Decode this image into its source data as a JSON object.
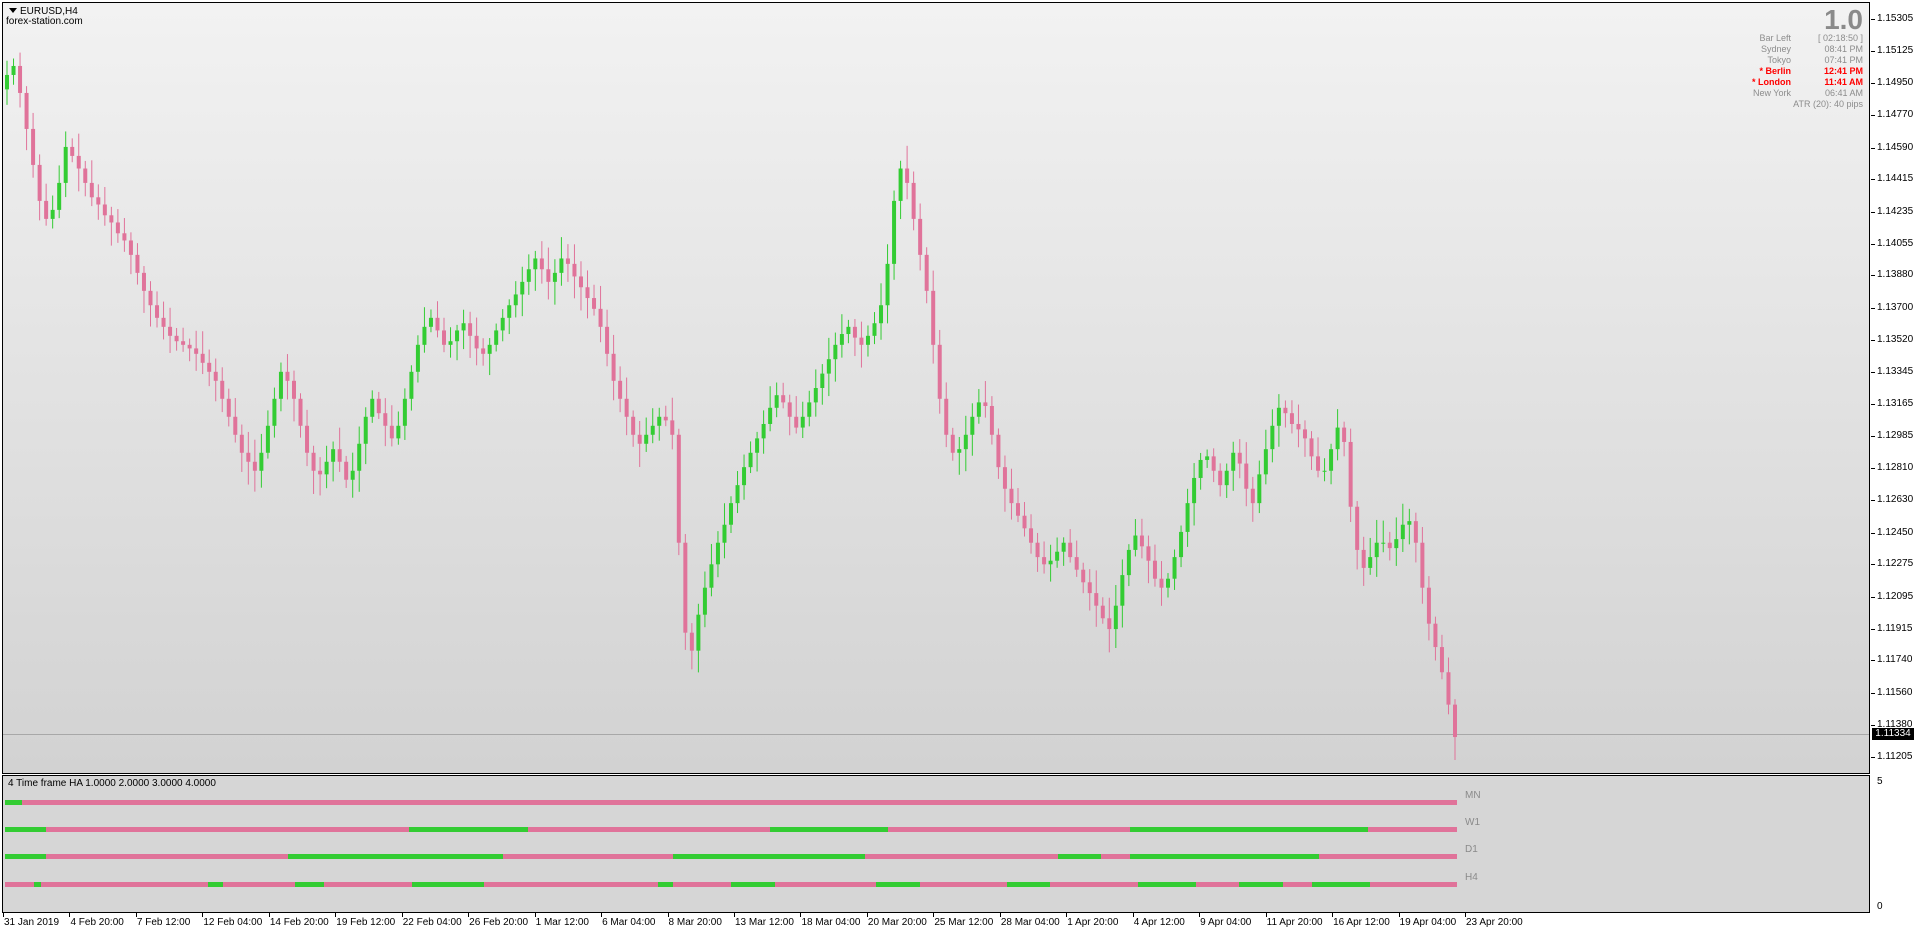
{
  "symbol": "EURUSD,H4",
  "watermark": "forex-station.com",
  "top_right_number": "1.0",
  "sessions": [
    {
      "name": "Bar Left",
      "value": "[ 02:18:50 ]",
      "active": false
    },
    {
      "name": "Sydney",
      "value": "08:41 PM",
      "active": false
    },
    {
      "name": "Tokyo",
      "value": "07:41 PM",
      "active": false
    },
    {
      "name": "* Berlin",
      "value": "12:41 PM",
      "active": true
    },
    {
      "name": "* London",
      "value": "11:41 AM",
      "active": true
    },
    {
      "name": "New York",
      "value": "06:41 AM",
      "active": false
    }
  ],
  "atr_text": "ATR (20): 40 pips",
  "current_price": "1.11334",
  "price_axis": [
    "1.15305",
    "1.15125",
    "1.14950",
    "1.14770",
    "1.14590",
    "1.14415",
    "1.14235",
    "1.14055",
    "1.13880",
    "1.13700",
    "1.13520",
    "1.13345",
    "1.13165",
    "1.12985",
    "1.12810",
    "1.12630",
    "1.12450",
    "1.12275",
    "1.12095",
    "1.11915",
    "1.11740",
    "1.11560",
    "1.11380",
    "1.11205"
  ],
  "time_axis": [
    "31 Jan 2019",
    "4 Feb 20:00",
    "7 Feb 12:00",
    "12 Feb 04:00",
    "14 Feb 20:00",
    "19 Feb 12:00",
    "22 Feb 04:00",
    "26 Feb 20:00",
    "1 Mar 12:00",
    "6 Mar 04:00",
    "8 Mar 20:00",
    "13 Mar 12:00",
    "18 Mar 04:00",
    "20 Mar 20:00",
    "25 Mar 12:00",
    "28 Mar 04:00",
    "1 Apr 20:00",
    "4 Apr 12:00",
    "9 Apr 04:00",
    "11 Apr 20:00",
    "16 Apr 12:00",
    "19 Apr 04:00",
    "23 Apr 20:00"
  ],
  "indicator": {
    "title": "4 Time frame HA 1.0000 2.0000 3.0000 4.0000",
    "axis_max": "5",
    "axis_min": "0",
    "rows": [
      {
        "label": "MN",
        "segments": [
          [
            "up",
            0,
            0.012
          ],
          [
            "down",
            0.012,
            1
          ]
        ]
      },
      {
        "label": "W1",
        "segments": [
          [
            "up",
            0,
            0.028
          ],
          [
            "down",
            0.028,
            0.278
          ],
          [
            "up",
            0.278,
            0.36
          ],
          [
            "down",
            0.36,
            0.527
          ],
          [
            "up",
            0.527,
            0.608
          ],
          [
            "down",
            0.608,
            0.775
          ],
          [
            "up",
            0.775,
            0.939
          ],
          [
            "down",
            0.939,
            1
          ]
        ]
      },
      {
        "label": "D1",
        "segments": [
          [
            "up",
            0,
            0.028
          ],
          [
            "down",
            0.028,
            0.195
          ],
          [
            "up",
            0.195,
            0.343
          ],
          [
            "down",
            0.343,
            0.46
          ],
          [
            "up",
            0.46,
            0.592
          ],
          [
            "down",
            0.592,
            0.725
          ],
          [
            "up",
            0.725,
            0.755
          ],
          [
            "down",
            0.755,
            0.775
          ],
          [
            "up",
            0.775,
            0.905
          ],
          [
            "down",
            0.905,
            1
          ]
        ]
      },
      {
        "label": "H4",
        "segments": [
          [
            "down",
            0,
            0.02
          ],
          [
            "up",
            0.02,
            0.025
          ],
          [
            "down",
            0.025,
            0.14
          ],
          [
            "up",
            0.14,
            0.15
          ],
          [
            "down",
            0.15,
            0.2
          ],
          [
            "up",
            0.2,
            0.22
          ],
          [
            "down",
            0.22,
            0.28
          ],
          [
            "up",
            0.28,
            0.33
          ],
          [
            "down",
            0.33,
            0.45
          ],
          [
            "up",
            0.45,
            0.46
          ],
          [
            "down",
            0.46,
            0.5
          ],
          [
            "up",
            0.5,
            0.53
          ],
          [
            "down",
            0.53,
            0.6
          ],
          [
            "up",
            0.6,
            0.63
          ],
          [
            "down",
            0.63,
            0.69
          ],
          [
            "up",
            0.69,
            0.72
          ],
          [
            "down",
            0.72,
            0.78
          ],
          [
            "up",
            0.78,
            0.82
          ],
          [
            "down",
            0.82,
            0.85
          ],
          [
            "up",
            0.85,
            0.88
          ],
          [
            "down",
            0.88,
            0.9
          ],
          [
            "up",
            0.9,
            0.94
          ],
          [
            "down",
            0.94,
            1
          ]
        ]
      }
    ]
  },
  "colors": {
    "bull": "#33cc33",
    "bear": "#e0739a",
    "wick_bull": "#33cc33",
    "wick_bear": "#e0739a"
  },
  "chart_data": {
    "type": "candlestick",
    "ylim": [
      1.1112,
      1.154
    ],
    "points": [
      1.15,
      1.1505,
      1.149,
      1.147,
      1.145,
      1.143,
      1.142,
      1.1425,
      1.144,
      1.146,
      1.1455,
      1.1448,
      1.144,
      1.1432,
      1.1428,
      1.1422,
      1.1418,
      1.1412,
      1.1408,
      1.14,
      1.139,
      1.138,
      1.1372,
      1.1365,
      1.136,
      1.1355,
      1.1352,
      1.135,
      1.1348,
      1.1345,
      1.134,
      1.1335,
      1.133,
      1.132,
      1.131,
      1.13,
      1.129,
      1.1285,
      1.128,
      1.129,
      1.1305,
      1.132,
      1.1335,
      1.133,
      1.132,
      1.1305,
      1.129,
      1.128,
      1.1278,
      1.1285,
      1.1292,
      1.1285,
      1.1275,
      1.128,
      1.1295,
      1.131,
      1.132,
      1.1312,
      1.1305,
      1.1298,
      1.1305,
      1.132,
      1.1335,
      1.135,
      1.136,
      1.1365,
      1.1358,
      1.135,
      1.1352,
      1.1358,
      1.1362,
      1.1355,
      1.1348,
      1.1345,
      1.135,
      1.1358,
      1.1365,
      1.1372,
      1.1378,
      1.1385,
      1.1392,
      1.1398,
      1.1392,
      1.1385,
      1.139,
      1.1398,
      1.1395,
      1.1388,
      1.1382,
      1.1376,
      1.137,
      1.136,
      1.1345,
      1.133,
      1.132,
      1.131,
      1.13,
      1.1295,
      1.13,
      1.1305,
      1.131,
      1.1308,
      1.13,
      1.124,
      1.119,
      1.118,
      1.12,
      1.1215,
      1.1228,
      1.124,
      1.125,
      1.1262,
      1.1272,
      1.1282,
      1.129,
      1.1298,
      1.1306,
      1.1315,
      1.1322,
      1.1318,
      1.131,
      1.1304,
      1.131,
      1.1318,
      1.1326,
      1.1334,
      1.1342,
      1.135,
      1.1356,
      1.136,
      1.1354,
      1.135,
      1.1355,
      1.1362,
      1.1372,
      1.1395,
      1.143,
      1.1448,
      1.144,
      1.142,
      1.14,
      1.138,
      1.135,
      1.132,
      1.13,
      1.129,
      1.1292,
      1.13,
      1.131,
      1.1318,
      1.1316,
      1.13,
      1.1282,
      1.127,
      1.1262,
      1.1255,
      1.1248,
      1.124,
      1.1232,
      1.1228,
      1.123,
      1.1235,
      1.124,
      1.1232,
      1.1225,
      1.1218,
      1.1212,
      1.1205,
      1.1198,
      1.1192,
      1.1205,
      1.1222,
      1.1236,
      1.1244,
      1.1238,
      1.123,
      1.122,
      1.1215,
      1.122,
      1.1232,
      1.1246,
      1.1262,
      1.1276,
      1.1286,
      1.1288,
      1.128,
      1.1272,
      1.128,
      1.129,
      1.1284,
      1.127,
      1.1262,
      1.1278,
      1.1292,
      1.1305,
      1.1315,
      1.1312,
      1.1306,
      1.1303,
      1.1298,
      1.1288,
      1.128,
      1.128,
      1.1292,
      1.1304,
      1.1296,
      1.126,
      1.1236,
      1.1226,
      1.1232,
      1.124,
      1.124,
      1.1237,
      1.1242,
      1.125,
      1.1252,
      1.124,
      1.1215,
      1.1195,
      1.1182,
      1.1168,
      1.115,
      1.1132
    ]
  }
}
